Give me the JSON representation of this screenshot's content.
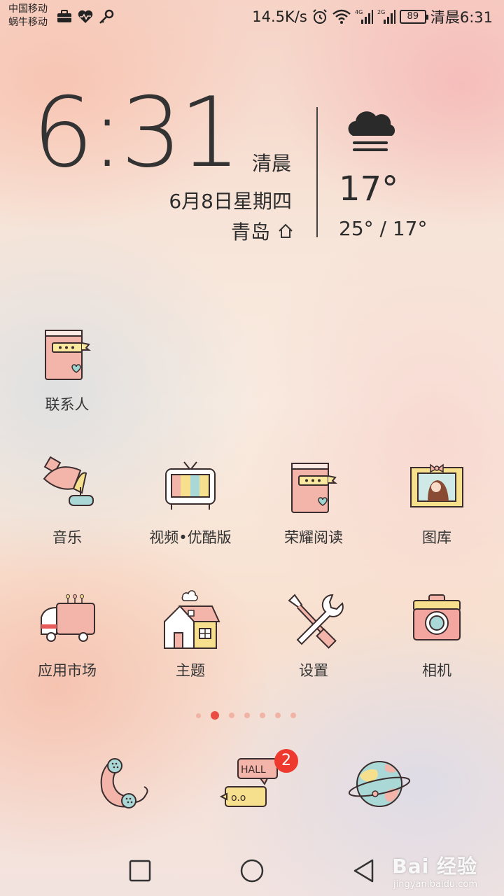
{
  "status_bar": {
    "carrier_1": "中国移动",
    "carrier_2": "蜗牛移动",
    "left_icons": [
      "briefcase-icon",
      "heart-pulse-icon",
      "key-icon"
    ],
    "net_speed": "14.5K/s",
    "sim1_network": "4G",
    "sim2_network": "2G",
    "battery": "89",
    "time": "清晨6:31"
  },
  "clock_widget": {
    "time": "6:31",
    "period": "清晨",
    "date": "6月8日星期四",
    "city": "青岛",
    "weather_icon": "cloud-fog-icon",
    "temperature": "17°",
    "range": "25° / 17°"
  },
  "apps": [
    {
      "label": "联系人",
      "icon": "contacts-book-icon"
    },
    {
      "label": "音乐",
      "icon": "gramophone-icon"
    },
    {
      "label": "视频•优酷版",
      "icon": "tv-icon"
    },
    {
      "label": "荣耀阅读",
      "icon": "reading-book-icon"
    },
    {
      "label": "图库",
      "icon": "photo-frame-icon"
    },
    {
      "label": "应用市场",
      "icon": "truck-icon"
    },
    {
      "label": "主题",
      "icon": "house-icon"
    },
    {
      "label": "设置",
      "icon": "tools-icon"
    },
    {
      "label": "相机",
      "icon": "camera-icon"
    }
  ],
  "page_indicator": {
    "count": 7,
    "current": 2
  },
  "dock": [
    {
      "icon": "phone-icon"
    },
    {
      "icon": "messages-icon",
      "badge": "2",
      "bubble_text_1": "HALL",
      "bubble_text_2": "o.o"
    },
    {
      "icon": "planet-browser-icon"
    }
  ],
  "colors": {
    "accent": "#ea4b43",
    "badge": "#ee3a2e"
  },
  "watermark": {
    "main": "Bai 经验",
    "sub": "jingyan.baidu.com"
  }
}
